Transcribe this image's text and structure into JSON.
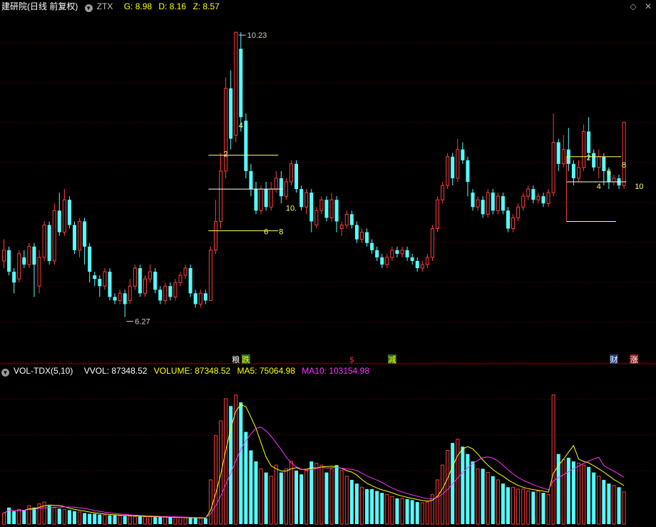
{
  "header": {
    "title": "建研院(日线 前复权)",
    "indicator_name": "ZTX",
    "g_label": "G: 8.98",
    "d_label": "D: 8.16",
    "z_label": "Z: 8.57"
  },
  "window_icons": {
    "diamond": "◇",
    "close": "✕"
  },
  "volume_header": {
    "indicator": "VOL-TDX(5,10)",
    "vvol": "VVOL: 87348.52",
    "volume": "VOLUME: 87348.52",
    "ma5": "MA5: 75064.98",
    "ma10": "MA10: 103154.98"
  },
  "colors": {
    "up": "#ff3c3c",
    "down": "#54ffff",
    "grid": "#7a0000",
    "ma5": "#ffff00",
    "ma10": "#ff33ff"
  },
  "chart_data": {
    "type": "candlestick",
    "price_range": [
      5.8,
      10.5
    ],
    "volume_range": [
      0,
      400000
    ],
    "max_label": "10.23",
    "min_label": "6.27",
    "candles": [
      [
        7.05,
        7.2,
        7.35,
        6.95
      ],
      [
        7.2,
        6.9,
        7.25,
        6.85
      ],
      [
        6.9,
        6.75,
        6.95,
        6.6
      ],
      [
        6.8,
        7.15,
        7.2,
        6.75
      ],
      [
        7.1,
        7.0,
        7.2,
        6.95
      ],
      [
        7.0,
        7.25,
        7.3,
        6.95
      ],
      [
        7.25,
        7.0,
        7.3,
        6.55
      ],
      [
        6.7,
        7.1,
        7.2,
        6.6
      ],
      [
        7.1,
        7.55,
        7.6,
        7.05
      ],
      [
        7.55,
        7.05,
        7.6,
        7.0
      ],
      [
        7.05,
        7.75,
        7.85,
        7.0
      ],
      [
        7.75,
        7.45,
        8.0,
        7.4
      ],
      [
        7.45,
        7.9,
        8.05,
        7.4
      ],
      [
        7.9,
        7.55,
        7.95,
        7.5
      ],
      [
        7.55,
        7.2,
        7.6,
        7.15
      ],
      [
        7.2,
        7.6,
        7.65,
        7.1
      ],
      [
        7.6,
        7.25,
        7.65,
        7.0
      ],
      [
        7.25,
        6.9,
        7.3,
        6.75
      ],
      [
        6.85,
        6.8,
        6.9,
        6.7
      ],
      [
        6.8,
        6.7,
        6.85,
        6.55
      ],
      [
        6.7,
        6.9,
        6.95,
        6.65
      ],
      [
        6.9,
        6.55,
        6.95,
        6.5
      ],
      [
        6.55,
        6.5,
        6.6,
        6.45
      ],
      [
        6.5,
        6.6,
        6.65,
        6.45
      ],
      [
        6.6,
        6.45,
        6.65,
        6.27
      ],
      [
        6.5,
        6.7,
        6.8,
        6.45
      ],
      [
        6.7,
        6.95,
        7.0,
        6.65
      ],
      [
        6.95,
        6.6,
        7.0,
        6.55
      ],
      [
        6.6,
        6.8,
        6.85,
        6.55
      ],
      [
        6.8,
        6.9,
        7.0,
        6.75
      ],
      [
        6.9,
        6.65,
        6.95,
        6.6
      ],
      [
        6.65,
        6.5,
        6.7,
        6.45
      ],
      [
        6.5,
        6.7,
        6.75,
        6.45
      ],
      [
        6.7,
        6.55,
        6.75,
        6.5
      ],
      [
        6.55,
        6.75,
        6.8,
        6.5
      ],
      [
        6.75,
        6.85,
        6.9,
        6.7
      ],
      [
        6.85,
        6.95,
        7.0,
        6.8
      ],
      [
        6.95,
        6.6,
        7.0,
        6.55
      ],
      [
        6.6,
        6.45,
        6.65,
        6.4
      ],
      [
        6.45,
        6.6,
        6.65,
        6.4
      ],
      [
        6.6,
        6.5,
        6.65,
        6.45
      ],
      [
        6.5,
        7.2,
        7.25,
        6.5
      ],
      [
        7.2,
        7.6,
        7.9,
        7.15
      ],
      [
        7.6,
        8.3,
        8.55,
        7.5
      ],
      [
        8.3,
        9.45,
        9.6,
        8.2
      ],
      [
        9.45,
        8.75,
        9.7,
        8.6
      ],
      [
        8.8,
        10.23,
        10.23,
        8.7
      ],
      [
        10.0,
        9.05,
        10.23,
        8.85
      ],
      [
        9.0,
        8.3,
        9.1,
        8.2
      ],
      [
        8.3,
        8.05,
        8.4,
        7.95
      ],
      [
        8.05,
        7.75,
        8.15,
        7.7
      ],
      [
        7.75,
        8.05,
        8.1,
        7.7
      ],
      [
        8.05,
        7.8,
        8.15,
        7.75
      ],
      [
        7.8,
        8.05,
        8.15,
        7.75
      ],
      [
        8.05,
        8.2,
        8.3,
        8.0
      ],
      [
        8.2,
        7.95,
        8.3,
        7.85
      ],
      [
        7.95,
        8.15,
        8.2,
        7.9
      ],
      [
        8.15,
        8.4,
        8.45,
        8.1
      ],
      [
        8.4,
        8.05,
        8.45,
        8.0
      ],
      [
        8.05,
        7.8,
        8.1,
        7.75
      ],
      [
        7.8,
        8.0,
        8.05,
        7.7
      ],
      [
        8.0,
        7.6,
        8.05,
        7.45
      ],
      [
        7.55,
        7.75,
        7.8,
        7.5
      ],
      [
        7.75,
        7.9,
        7.95,
        7.7
      ],
      [
        7.9,
        7.65,
        7.95,
        7.6
      ],
      [
        7.65,
        7.9,
        8.0,
        7.6
      ],
      [
        7.9,
        7.6,
        7.95,
        7.45
      ],
      [
        7.5,
        7.55,
        7.6,
        7.4
      ],
      [
        7.55,
        7.7,
        7.75,
        7.5
      ],
      [
        7.7,
        7.55,
        7.75,
        7.5
      ],
      [
        7.55,
        7.35,
        7.6,
        7.3
      ],
      [
        7.35,
        7.45,
        7.5,
        7.3
      ],
      [
        7.45,
        7.3,
        7.5,
        7.25
      ],
      [
        7.3,
        7.2,
        7.35,
        7.15
      ],
      [
        7.2,
        7.1,
        7.25,
        7.05
      ],
      [
        7.1,
        7.0,
        7.15,
        6.95
      ],
      [
        7.0,
        7.1,
        7.15,
        6.95
      ],
      [
        7.1,
        7.2,
        7.25,
        7.05
      ],
      [
        7.2,
        7.15,
        7.25,
        7.1
      ],
      [
        7.15,
        7.2,
        7.25,
        7.1
      ],
      [
        7.2,
        7.1,
        7.25,
        7.05
      ],
      [
        7.1,
        7.05,
        7.15,
        7.0
      ],
      [
        7.05,
        6.95,
        7.1,
        6.9
      ],
      [
        6.95,
        7.0,
        7.05,
        6.9
      ],
      [
        7.0,
        7.1,
        7.15,
        6.95
      ],
      [
        7.1,
        7.5,
        7.55,
        7.05
      ],
      [
        7.5,
        7.9,
        7.95,
        7.45
      ],
      [
        7.9,
        8.1,
        8.15,
        7.85
      ],
      [
        8.1,
        8.5,
        8.55,
        8.05
      ],
      [
        8.5,
        8.2,
        8.55,
        8.1
      ],
      [
        8.2,
        8.6,
        8.75,
        8.15
      ],
      [
        8.6,
        8.45,
        8.7,
        8.4
      ],
      [
        8.45,
        8.15,
        8.5,
        7.95
      ],
      [
        8.0,
        7.8,
        8.05,
        7.75
      ],
      [
        7.8,
        7.9,
        7.95,
        7.75
      ],
      [
        7.9,
        7.7,
        7.95,
        7.65
      ],
      [
        7.7,
        8.0,
        8.05,
        7.65
      ],
      [
        8.0,
        7.75,
        8.05,
        7.7
      ],
      [
        7.75,
        7.95,
        8.0,
        7.7
      ],
      [
        7.95,
        7.75,
        8.0,
        7.7
      ],
      [
        7.75,
        7.5,
        7.8,
        7.45
      ],
      [
        7.5,
        7.65,
        7.7,
        7.45
      ],
      [
        7.65,
        7.8,
        7.85,
        7.6
      ],
      [
        7.8,
        7.95,
        8.0,
        7.75
      ],
      [
        7.95,
        8.05,
        8.1,
        7.9
      ],
      [
        8.05,
        7.9,
        8.1,
        7.85
      ],
      [
        7.9,
        7.95,
        8.0,
        7.85
      ],
      [
        7.95,
        7.85,
        8.0,
        7.8
      ],
      [
        7.85,
        8.0,
        8.05,
        7.8
      ],
      [
        8.0,
        8.7,
        9.1,
        7.95
      ],
      [
        8.7,
        8.4,
        8.75,
        8.3
      ],
      [
        8.4,
        8.6,
        8.8,
        8.35
      ],
      [
        8.6,
        8.4,
        8.9,
        8.3
      ],
      [
        8.4,
        8.2,
        8.45,
        8.1
      ],
      [
        8.2,
        8.35,
        8.45,
        8.15
      ],
      [
        8.35,
        8.85,
        8.95,
        8.3
      ],
      [
        8.85,
        8.55,
        9.05,
        8.45
      ],
      [
        8.55,
        8.35,
        8.6,
        8.3
      ],
      [
        8.35,
        8.5,
        8.6,
        8.2
      ],
      [
        8.5,
        8.3,
        8.55,
        8.1
      ],
      [
        8.3,
        8.15,
        8.35,
        8.05
      ],
      [
        8.15,
        8.2,
        8.25,
        8.1
      ],
      [
        8.2,
        8.1,
        8.25,
        8.05
      ],
      [
        8.1,
        8.98,
        8.98,
        8.05
      ]
    ],
    "volumes": [
      30000,
      45000,
      35000,
      40000,
      38000,
      50000,
      45000,
      55000,
      60000,
      50000,
      45000,
      42000,
      40000,
      38000,
      35000,
      33000,
      30000,
      28000,
      28000,
      26000,
      25000,
      24000,
      24000,
      23000,
      22000,
      22000,
      21000,
      21000,
      20000,
      20000,
      19000,
      19000,
      19000,
      18000,
      18000,
      18000,
      17000,
      17000,
      17000,
      16000,
      16000,
      120000,
      240000,
      280000,
      340000,
      320000,
      350000,
      330000,
      250000,
      200000,
      170000,
      150000,
      140000,
      130000,
      160000,
      140000,
      150000,
      170000,
      145000,
      135000,
      145000,
      170000,
      165000,
      160000,
      140000,
      150000,
      160000,
      145000,
      130000,
      120000,
      110000,
      100000,
      95000,
      95000,
      90000,
      85000,
      80000,
      75000,
      70000,
      70000,
      68000,
      65000,
      60000,
      58000,
      60000,
      80000,
      120000,
      160000,
      200000,
      220000,
      230000,
      210000,
      190000,
      170000,
      150000,
      150000,
      140000,
      130000,
      120000,
      110000,
      100000,
      100000,
      95000,
      95000,
      90000,
      88000,
      90000,
      85000,
      80000,
      350000,
      190000,
      175000,
      180000,
      170000,
      165000,
      160000,
      155000,
      140000,
      130000,
      120000,
      110000,
      105000,
      100000,
      87348.52
    ],
    "annotations": [
      {
        "i": 47,
        "price": 8.9,
        "text": "4"
      },
      {
        "i": 44,
        "price": 8.5,
        "text": "2"
      },
      {
        "i": 57,
        "price": 7.75,
        "text": "10."
      },
      {
        "i": 52,
        "price": 7.42,
        "text": "6"
      },
      {
        "i": 55,
        "price": 7.42,
        "text": "8"
      },
      {
        "i": 116,
        "price": 8.45,
        "text": "2"
      },
      {
        "i": 118,
        "price": 8.05,
        "text": "4"
      },
      {
        "i": 120,
        "price": 8.25,
        "text": "6"
      },
      {
        "i": 123,
        "price": 8.35,
        "text": "8"
      },
      {
        "i": 126,
        "price": 8.05,
        "text": "10"
      }
    ],
    "signals": [
      {
        "i": 46,
        "text": "粮",
        "color": "#ffffff"
      },
      {
        "i": 48,
        "text": "跌",
        "color": "#ffff00",
        "bg": "#2a6a2a"
      },
      {
        "i": 69,
        "text": "$",
        "color": "#ff3333"
      },
      {
        "i": 77,
        "text": "减",
        "color": "#ffff00",
        "bg": "#2a6a2a"
      },
      {
        "i": 121,
        "text": "财",
        "color": "#ffffff",
        "bg": "#1e3a7a"
      },
      {
        "i": 125,
        "text": "涨",
        "color": "#ffffff",
        "bg": "#8a1e1e"
      }
    ]
  }
}
